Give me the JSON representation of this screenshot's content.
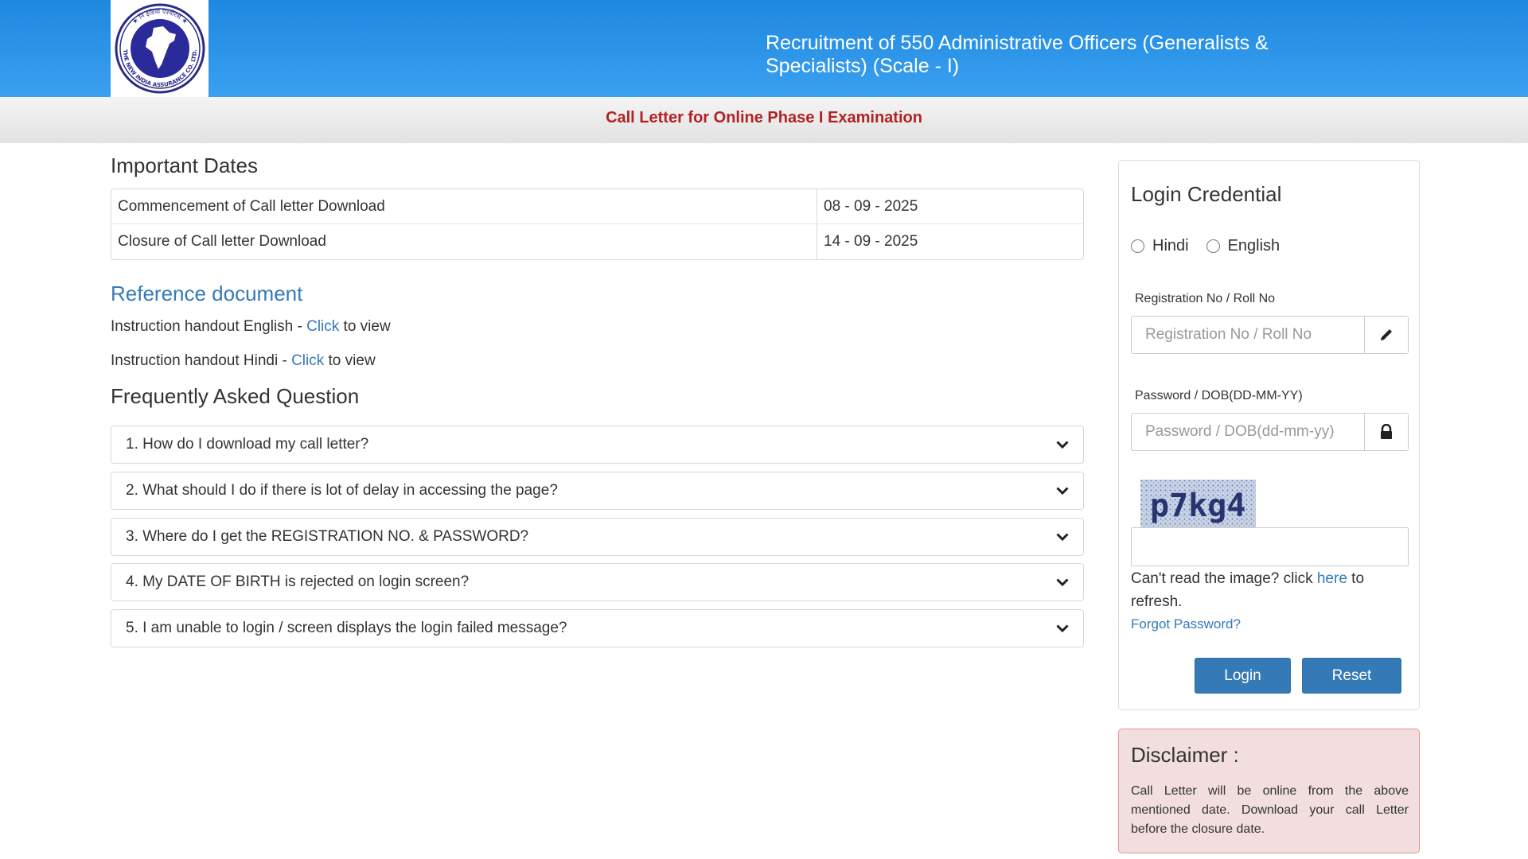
{
  "header": {
    "title": "Recruitment of 550 Administrative Officers (Generalists & Specialists) (Scale - I)",
    "subtitle": "Call Letter for Online Phase I Examination",
    "logo_text": "THE NEW INDIA ASSURANCE CO. LTD."
  },
  "important_dates": {
    "title": "Important Dates",
    "rows": [
      {
        "label": "Commencement of Call letter Download",
        "value": "08 - 09 - 2025"
      },
      {
        "label": "Closure of Call letter Download",
        "value": "14 - 09 - 2025"
      }
    ]
  },
  "reference": {
    "title": "Reference document",
    "items": [
      {
        "prefix": "Instruction handout English - ",
        "link": "Click",
        "suffix": " to view"
      },
      {
        "prefix": "Instruction handout Hindi - ",
        "link": "Click",
        "suffix": " to view"
      }
    ]
  },
  "faq": {
    "title": "Frequently Asked Question",
    "items": [
      "1. How do I download my call letter?",
      "2. What should I do if there is lot of delay in accessing the page?",
      "3. Where do I get the REGISTRATION NO. & PASSWORD?",
      "4. My DATE OF BIRTH is rejected on login screen?",
      "5. I am unable to login / screen displays the login failed message?"
    ]
  },
  "login": {
    "title": "Login Credential",
    "lang_hindi": "Hindi",
    "lang_english": "English",
    "reg_label": "Registration No / Roll No",
    "reg_placeholder": "Registration No / Roll No",
    "pwd_label": "Password / DOB(DD-MM-YY)",
    "pwd_placeholder": "Password / DOB(dd-mm-yy)",
    "captcha_text": "p7kg4",
    "refresh_prefix": "Can't read the image? click ",
    "refresh_link": "here",
    "refresh_suffix": " to refresh.",
    "forgot": "Forgot Password?",
    "login_button": "Login",
    "reset_button": "Reset"
  },
  "disclaimer": {
    "title": "Disclaimer :",
    "text": "Call Letter will be online from the above mentioned date. Download your call Letter before the closure date."
  },
  "colors": {
    "header_blue": "#1e88e0",
    "link_blue": "#337ab7",
    "subtitle_red": "#b22222",
    "disclaimer_bg": "#f2dede"
  },
  "icons": {
    "reg_addon": "pencil-icon",
    "pwd_addon": "lock-icon",
    "faq_toggle": "chevron-down-icon"
  }
}
